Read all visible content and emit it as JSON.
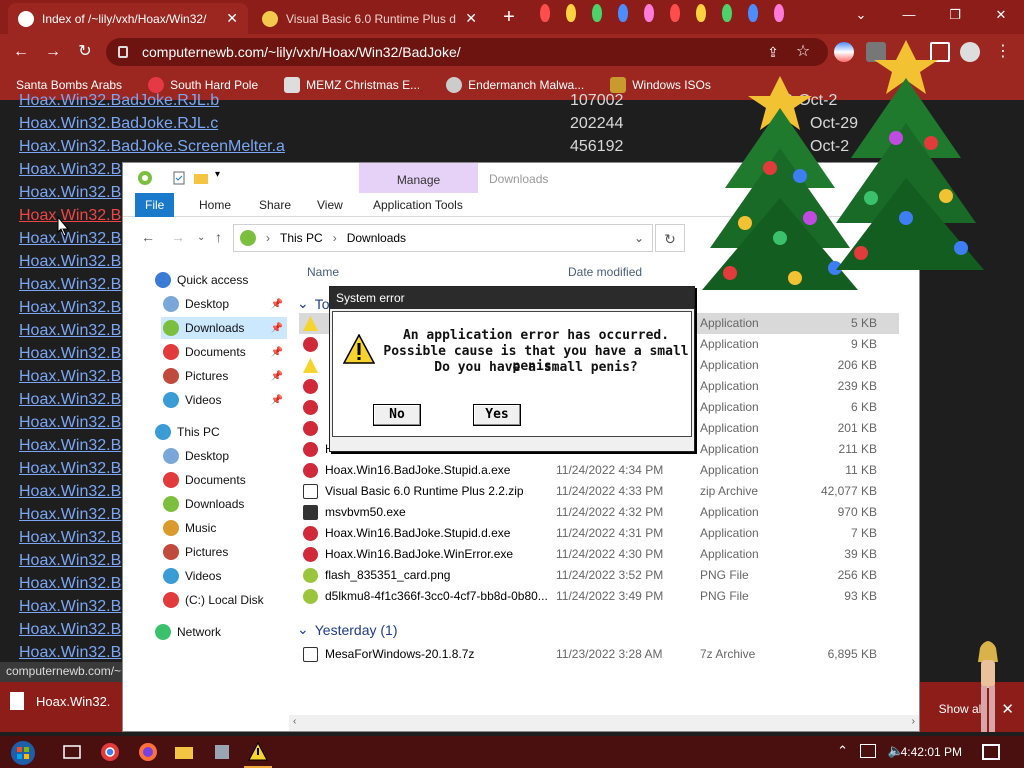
{
  "browser": {
    "active_tab": "Index of /~lily/vxh/Hoax/Win32/",
    "inactive_tab": "Visual Basic 6.0 Runtime Plus d",
    "url": "computernewb.com/~lily/vxh/Hoax/Win32/BadJoke/",
    "bookmarks": [
      "Santa Bombs Arabs",
      "South Hard Pole",
      "MEMZ Christmas E...",
      "Endermanch Malwa...",
      "Windows ISOs"
    ],
    "status_url": "computernewb.com/~"
  },
  "listing": {
    "rows": [
      {
        "name": "Hoax.Win32.BadJoke.RJL.c",
        "size": "202244",
        "date": "Oct-29"
      },
      {
        "name": "Hoax.Win32.BadJoke.ScreenMelter.a",
        "size": "456192",
        "date": "Oct-2"
      }
    ],
    "truncated_prefix": "Hoax.Win32.B",
    "hover_prefix": "Hoax.Win32.B",
    "top_partial": "Hoax.Win32.BadJoke.RJL.b",
    "top_partial_size": "107002",
    "top_partial_date": "0-Oct-2"
  },
  "download_bar": {
    "item": "Hoax.Win32.",
    "show_all": "Show all"
  },
  "explorer": {
    "context_tab": "Manage",
    "context_title": "Downloads",
    "ribbon": [
      "File",
      "Home",
      "Share",
      "View",
      "Application Tools"
    ],
    "path": [
      "This PC",
      "Downloads"
    ],
    "nav": [
      {
        "label": "Quick access",
        "level": 0
      },
      {
        "label": "Desktop",
        "level": 1,
        "pin": true
      },
      {
        "label": "Downloads",
        "level": 1,
        "pin": true,
        "selected": true
      },
      {
        "label": "Documents",
        "level": 1,
        "pin": true
      },
      {
        "label": "Pictures",
        "level": 1,
        "pin": true
      },
      {
        "label": "Videos",
        "level": 1,
        "pin": true
      },
      {
        "label": "This PC",
        "level": 0
      },
      {
        "label": "Desktop",
        "level": 1
      },
      {
        "label": "Documents",
        "level": 1
      },
      {
        "label": "Downloads",
        "level": 1
      },
      {
        "label": "Music",
        "level": 1
      },
      {
        "label": "Pictures",
        "level": 1
      },
      {
        "label": "Videos",
        "level": 1
      },
      {
        "label": "(C:) Local Disk",
        "level": 1
      },
      {
        "label": "Network",
        "level": 0
      }
    ],
    "columns": {
      "name": "Name",
      "date": "Date modified"
    },
    "group_today": "Tod",
    "group_yesterday": "Yesterday (1)",
    "files_today": [
      {
        "name": "",
        "date": "",
        "type": "Application",
        "size": "5 KB",
        "icon": "warning-icon",
        "selected": true
      },
      {
        "name": "",
        "date": "",
        "type": "Application",
        "size": "9 KB",
        "icon": "app-icon"
      },
      {
        "name": "",
        "date": "",
        "type": "Application",
        "size": "206 KB",
        "icon": "warning-icon"
      },
      {
        "name": "",
        "date": "",
        "type": "Application",
        "size": "239 KB",
        "icon": "app-icon"
      },
      {
        "name": "",
        "date": "",
        "type": "Application",
        "size": "6 KB",
        "icon": "app-icon"
      },
      {
        "name": "",
        "date": "",
        "type": "Application",
        "size": "201 KB",
        "icon": "app-icon"
      },
      {
        "name": "Hoax.Win16.BadJoke.FakeFormat.exe",
        "date": "11/24/2022 4:35 PM",
        "type": "Application",
        "size": "211 KB",
        "icon": "app-icon"
      },
      {
        "name": "Hoax.Win16.BadJoke.Stupid.a.exe",
        "date": "11/24/2022 4:34 PM",
        "type": "Application",
        "size": "11 KB",
        "icon": "app-icon"
      },
      {
        "name": "Visual Basic 6.0 Runtime Plus 2.2.zip",
        "date": "11/24/2022 4:33 PM",
        "type": "zip Archive",
        "size": "42,077 KB",
        "icon": "zip-icon"
      },
      {
        "name": "msvbvm50.exe",
        "date": "11/24/2022 4:32 PM",
        "type": "Application",
        "size": "970 KB",
        "icon": "installer-icon"
      },
      {
        "name": "Hoax.Win16.BadJoke.Stupid.d.exe",
        "date": "11/24/2022 4:31 PM",
        "type": "Application",
        "size": "7 KB",
        "icon": "app-icon"
      },
      {
        "name": "Hoax.Win16.BadJoke.WinError.exe",
        "date": "11/24/2022 4:30 PM",
        "type": "Application",
        "size": "39 KB",
        "icon": "app-icon"
      },
      {
        "name": "flash_835351_card.png",
        "date": "11/24/2022 3:52 PM",
        "type": "PNG File",
        "size": "256 KB",
        "icon": "image-icon"
      },
      {
        "name": "d5lkmu8-4f1c366f-3cc0-4cf7-bb8d-0b80...",
        "date": "11/24/2022 3:49 PM",
        "type": "PNG File",
        "size": "93 KB",
        "icon": "image-icon"
      }
    ],
    "files_yesterday": [
      {
        "name": "MesaForWindows-20.1.8.7z",
        "date": "11/23/2022 3:28 AM",
        "type": "7z Archive",
        "size": "6,895 KB",
        "icon": "archive-icon"
      }
    ]
  },
  "dialog": {
    "title": "System error",
    "line1": "An application error has occurred.",
    "line2": "Possible cause is that you have a small penis.",
    "line3": "Do you have a small penis?",
    "no": "No",
    "yes": "Yes"
  },
  "taskbar": {
    "clock": "4:42:01 PM"
  },
  "colors": {
    "browser_chrome": "#9c2620",
    "page_bg": "#1e1e1e",
    "link": "#7ba6f4",
    "link_hover": "#f04545",
    "context_tab": "#e7d2f7",
    "file_tab": "#1979ca",
    "warning": "#f6d32d"
  }
}
